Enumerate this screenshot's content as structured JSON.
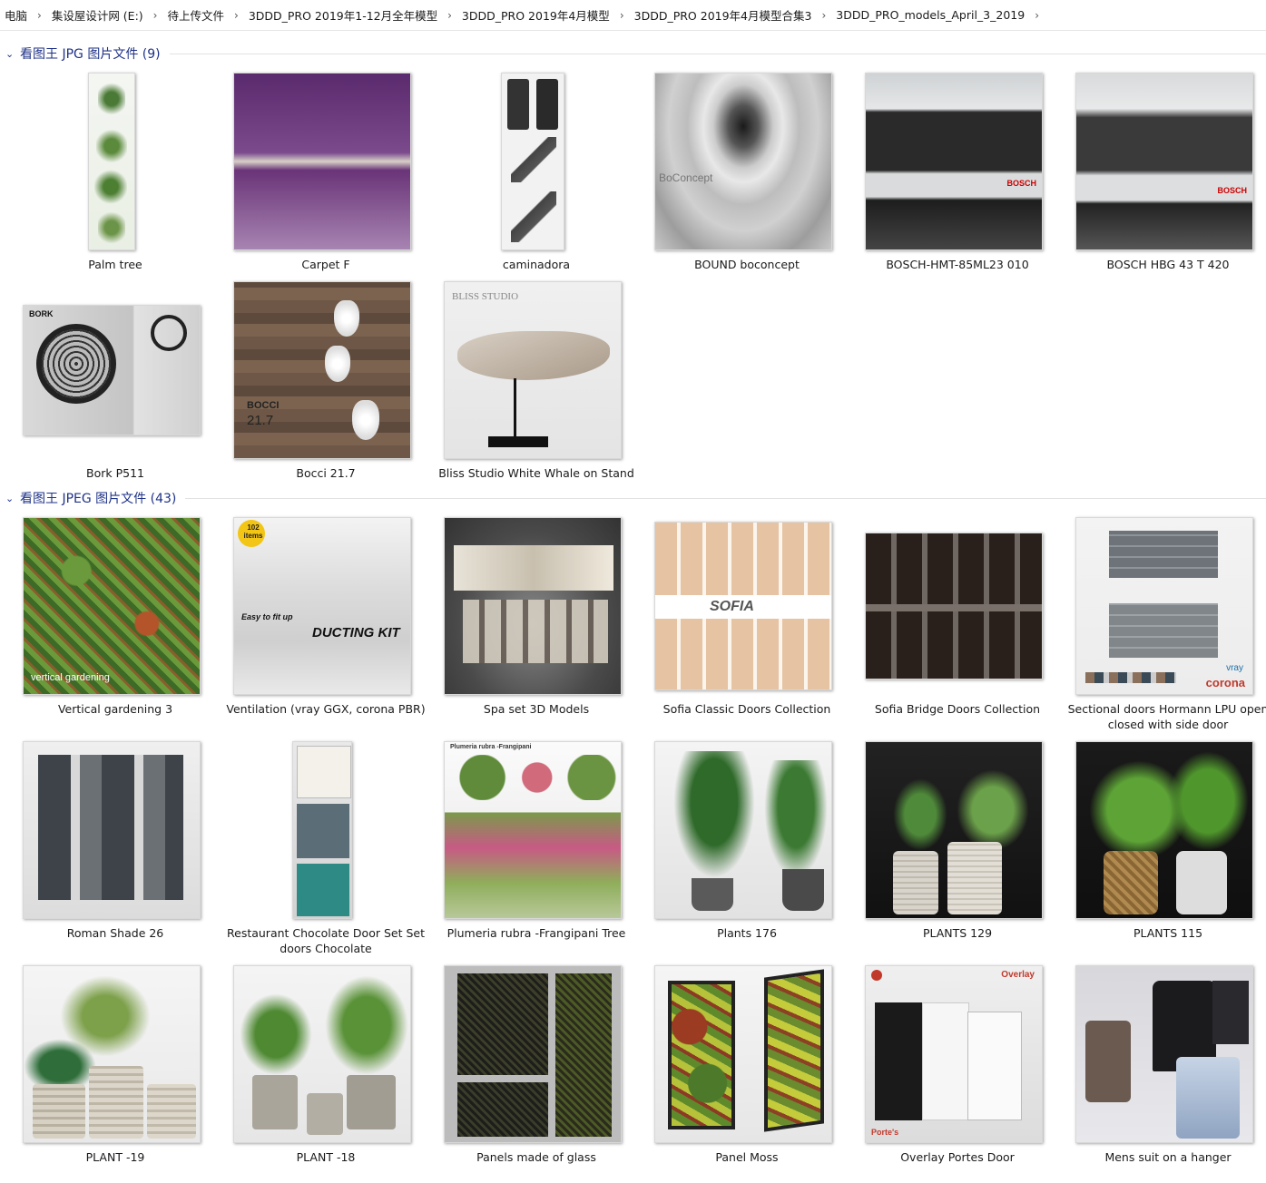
{
  "breadcrumb": [
    "电脑",
    "集设屋设计网 (E:)",
    "待上传文件",
    "3DDD_PRO 2019年1-12月全年模型",
    "3DDD_PRO 2019年4月模型",
    "3DDD_PRO 2019年4月模型合集3",
    "3DDD_PRO_models_April_3_2019"
  ],
  "groups": [
    {
      "title": "看图王 JPG 图片文件 (9)"
    },
    {
      "title": "看图王 JPEG 图片文件 (43)"
    }
  ],
  "jpg_items": [
    {
      "name": "Palm tree"
    },
    {
      "name": "Carpet F"
    },
    {
      "name": "caminadora"
    },
    {
      "name": "BOUND boconcept"
    },
    {
      "name": "BOSCH-HMT-85ML23 010"
    },
    {
      "name": "BOSCH HBG 43 T 420"
    },
    {
      "name": "Bork P511"
    },
    {
      "name": "Bocci 21.7"
    },
    {
      "name": "Bliss Studio White Whale on Stand"
    }
  ],
  "jpeg_items": [
    {
      "name": "Vertical gardening 3"
    },
    {
      "name": "Ventilation (vray GGX, corona PBR)"
    },
    {
      "name": "Spa set 3D Models"
    },
    {
      "name": "Sofia Classic Doors Collection"
    },
    {
      "name": "Sofia Bridge Doors Collection"
    },
    {
      "name": "Sectional doors Hormann LPU open closed with side door"
    },
    {
      "name": "Roman Shade 26"
    },
    {
      "name": "Restaurant Chocolate Door Set Set doors Chocolate"
    },
    {
      "name": "Plumeria rubra -Frangipani Tree"
    },
    {
      "name": "Plants 176"
    },
    {
      "name": "PLANTS 129"
    },
    {
      "name": "PLANTS 115"
    },
    {
      "name": "PLANT -19"
    },
    {
      "name": "PLANT -18"
    },
    {
      "name": "Panels made of glass"
    },
    {
      "name": "Panel Moss"
    },
    {
      "name": "Overlay Portes Door"
    },
    {
      "name": "Mens suit on a hanger"
    }
  ],
  "thumb_text": {
    "bork": "BORK",
    "bocci_brand": "BOCCI",
    "bocci_num": "21.7",
    "bliss": "BLISS STUDIO",
    "boconcept": "BoConcept",
    "bosch": "BOSCH",
    "vg": "vertical gardening",
    "ducting": "DUCTING KIT",
    "easy": "Easy to fit up",
    "items102": "102 items",
    "sofia": "SOFIA",
    "vray": "vray",
    "corona": "corona",
    "plumeria": "Plumeria rubra -Frangipani",
    "overlay": "Overlay",
    "portes": "Porte's"
  }
}
